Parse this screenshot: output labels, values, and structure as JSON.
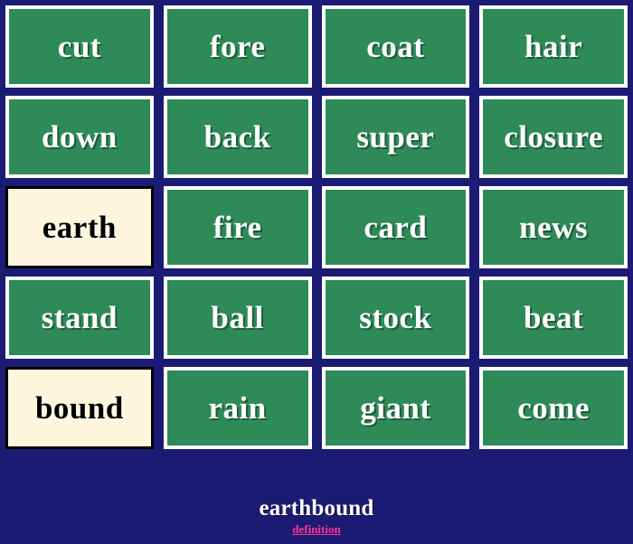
{
  "board": {
    "columns": 4,
    "rows": 5,
    "colors": {
      "background": "#1c1b74",
      "tile_default_bg": "#2e8b57",
      "tile_default_border": "#ffffff",
      "tile_default_text": "#ffffff",
      "tile_selected_bg": "#fdf5dc",
      "tile_selected_border": "#000000",
      "tile_selected_text": "#000000",
      "link_color": "#ff3399",
      "answer_text": "#ffffff"
    },
    "tiles": [
      {
        "label": "cut",
        "state": "default"
      },
      {
        "label": "fore",
        "state": "default"
      },
      {
        "label": "coat",
        "state": "default"
      },
      {
        "label": "hair",
        "state": "default"
      },
      {
        "label": "down",
        "state": "default"
      },
      {
        "label": "back",
        "state": "default"
      },
      {
        "label": "super",
        "state": "default"
      },
      {
        "label": "closure",
        "state": "default"
      },
      {
        "label": "earth",
        "state": "selected"
      },
      {
        "label": "fire",
        "state": "default"
      },
      {
        "label": "card",
        "state": "default"
      },
      {
        "label": "news",
        "state": "default"
      },
      {
        "label": "stand",
        "state": "default"
      },
      {
        "label": "ball",
        "state": "default"
      },
      {
        "label": "stock",
        "state": "default"
      },
      {
        "label": "beat",
        "state": "default"
      },
      {
        "label": "bound",
        "state": "selected"
      },
      {
        "label": "rain",
        "state": "default"
      },
      {
        "label": "giant",
        "state": "default"
      },
      {
        "label": "come",
        "state": "default"
      }
    ]
  },
  "answer": {
    "word": "earthbound",
    "definition_link_label": "definition"
  }
}
